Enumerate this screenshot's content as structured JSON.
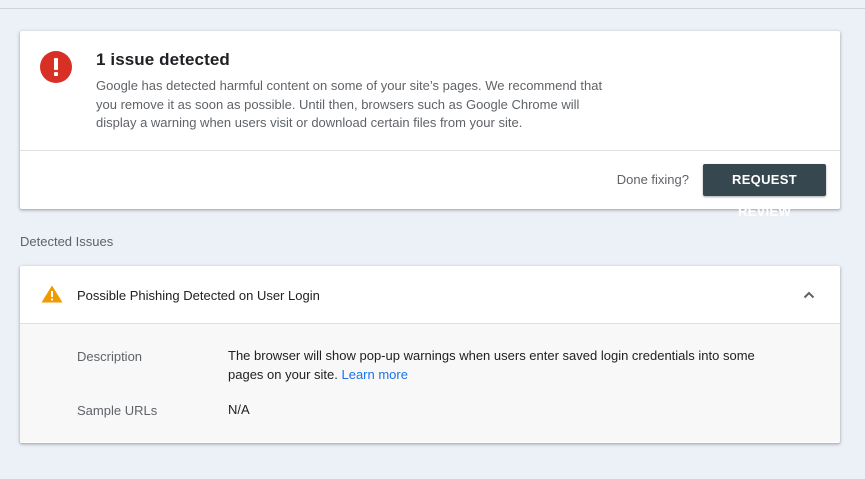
{
  "summary": {
    "title": "1 issue detected",
    "description": "Google has detected harmful content on some of your site’s pages. We recommend that you remove it as soon as possible. Until then, browsers such as Google Chrome will display a warning when users visit or download certain files from your site.",
    "done_text": "Done fixing?",
    "review_button": "REQUEST REVIEW"
  },
  "detected_issues": {
    "section_label": "Detected Issues",
    "items": [
      {
        "title": "Possible Phishing Detected on User Login",
        "description_label": "Description",
        "description": "The browser will show pop-up warnings when users enter saved login credentials into some pages on your site.",
        "learn_more": "Learn more",
        "sample_urls_label": "Sample URLs",
        "sample_urls": "N/A"
      }
    ]
  },
  "colors": {
    "error": "#d93025",
    "warning": "#f29900",
    "button": "#37474f",
    "link": "#1a73e8"
  },
  "icons": {
    "summary": "error-icon",
    "issue": "warning-icon",
    "collapse": "chevron-up-icon"
  }
}
